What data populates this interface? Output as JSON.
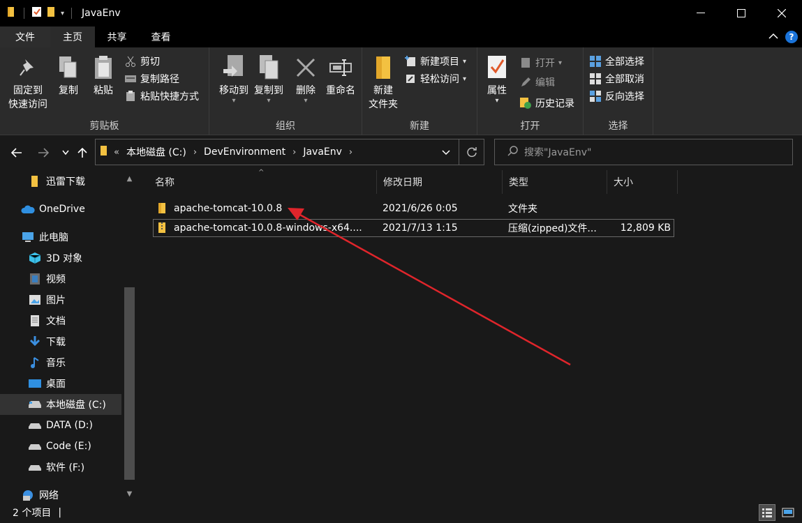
{
  "window": {
    "title": "JavaEnv"
  },
  "ribbon_tabs": [
    "文件",
    "主页",
    "共享",
    "查看"
  ],
  "ribbon": {
    "clipboard": {
      "label": "剪贴板",
      "pin": "固定到\n快速访问",
      "pin_line1": "固定到",
      "pin_line2": "快速访问",
      "copy": "复制",
      "paste": "粘贴",
      "cut": "剪切",
      "copy_path": "复制路径",
      "paste_shortcut": "粘贴快捷方式"
    },
    "organize": {
      "label": "组织",
      "move_to": "移动到",
      "copy_to": "复制到",
      "delete": "删除",
      "rename": "重命名"
    },
    "new": {
      "label": "新建",
      "new_folder_line1": "新建",
      "new_folder_line2": "文件夹",
      "new_item": "新建项目",
      "easy_access": "轻松访问"
    },
    "open": {
      "label": "打开",
      "properties": "属性",
      "open": "打开",
      "edit": "编辑",
      "history": "历史记录"
    },
    "select": {
      "label": "选择",
      "select_all": "全部选择",
      "select_none": "全部取消",
      "invert": "反向选择"
    }
  },
  "address": {
    "prefix": "«",
    "crumbs": [
      "本地磁盘 (C:)",
      "DevEnvironment",
      "JavaEnv"
    ]
  },
  "search": {
    "placeholder": "搜索\"JavaEnv\""
  },
  "sidebar": {
    "items": [
      {
        "label": "迅雷下载",
        "icon": "folder-icon"
      },
      {
        "label": "OneDrive",
        "icon": "cloud-icon"
      },
      {
        "label": "此电脑",
        "icon": "computer-icon"
      },
      {
        "label": "3D 对象",
        "icon": "cube-icon"
      },
      {
        "label": "视频",
        "icon": "video-icon"
      },
      {
        "label": "图片",
        "icon": "picture-icon"
      },
      {
        "label": "文档",
        "icon": "document-icon"
      },
      {
        "label": "下载",
        "icon": "download-icon"
      },
      {
        "label": "音乐",
        "icon": "music-icon"
      },
      {
        "label": "桌面",
        "icon": "desktop-icon"
      },
      {
        "label": "本地磁盘 (C:)",
        "icon": "drive-icon"
      },
      {
        "label": "DATA (D:)",
        "icon": "drive-icon"
      },
      {
        "label": "Code (E:)",
        "icon": "drive-icon"
      },
      {
        "label": "软件 (F:)",
        "icon": "drive-icon"
      },
      {
        "label": "网络",
        "icon": "network-icon"
      }
    ]
  },
  "columns": [
    "名称",
    "修改日期",
    "类型",
    "大小"
  ],
  "files": [
    {
      "name": "apache-tomcat-10.0.8",
      "date": "2021/6/26 0:05",
      "type": "文件夹",
      "size": "",
      "icon": "folder-icon"
    },
    {
      "name": "apache-tomcat-10.0.8-windows-x64....",
      "date": "2021/7/13 1:15",
      "type": "压缩(zipped)文件...",
      "size": "12,809 KB",
      "icon": "zip-folder-icon"
    }
  ],
  "status": {
    "count": "2 个项目",
    "sep": "|"
  },
  "colors": {
    "annotation_arrow": "#e0252b",
    "help": "#1a73d9"
  }
}
